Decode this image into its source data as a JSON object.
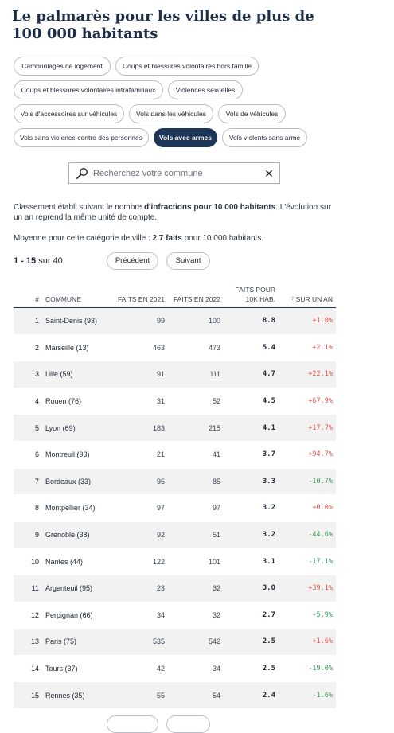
{
  "title": "Le palmarès pour les villes de plus de 100 000 habitants",
  "filters": [
    {
      "label": "Cambriolages de logement",
      "active": false
    },
    {
      "label": "Coups et blessures volontaires hors famille",
      "active": false
    },
    {
      "label": "Coups et blessures volontaires intrafamiliaux",
      "active": false
    },
    {
      "label": "Violences sexuelles",
      "active": false
    },
    {
      "label": "Vols d'accessoires sur véhicules",
      "active": false
    },
    {
      "label": "Vols dans les véhicules",
      "active": false
    },
    {
      "label": "Vols de véhicules",
      "active": false
    },
    {
      "label": "Vols sans violence contre des personnes",
      "active": false
    },
    {
      "label": "Vols avec armes",
      "active": true
    },
    {
      "label": "Vols violents sans arme",
      "active": false
    }
  ],
  "search": {
    "placeholder": "Recherchez votre commune",
    "clear_icon": "close-icon",
    "icon": "search-icon"
  },
  "info": {
    "line1_a": "Classement établi suivant le nombre ",
    "line1_b": "d'infractions pour 10 000 habitants",
    "line1_c": ". L'évolution sur un an reprend la même unité de compte.",
    "line2_a": "Moyenne pour cette catégorie de ville : ",
    "line2_b": "2.7 faits",
    "line2_c": " pour 10 000 habitants."
  },
  "pager": {
    "range": "1 - 15",
    "sep": " sur ",
    "total": "40",
    "prev": "Précédent",
    "next": "Suivant"
  },
  "table": {
    "headers": {
      "rank": "#",
      "city": "COMMUNE",
      "y2021": "FAITS EN 2021",
      "y2022": "FAITS EN 2022",
      "rate": "FAITS POUR 10K HAB.",
      "evo": "⁷ SUR UN AN"
    },
    "rows": [
      {
        "rank": "1",
        "city": "Saint-Denis (93)",
        "y2021": "99",
        "y2022": "100",
        "rate": "8.8",
        "evo": "+1.0%"
      },
      {
        "rank": "2",
        "city": "Marseille (13)",
        "y2021": "463",
        "y2022": "473",
        "rate": "5.4",
        "evo": "+2.1%"
      },
      {
        "rank": "3",
        "city": "Lille (59)",
        "y2021": "91",
        "y2022": "111",
        "rate": "4.7",
        "evo": "+22.1%"
      },
      {
        "rank": "4",
        "city": "Rouen (76)",
        "y2021": "31",
        "y2022": "52",
        "rate": "4.5",
        "evo": "+67.9%"
      },
      {
        "rank": "5",
        "city": "Lyon (69)",
        "y2021": "183",
        "y2022": "215",
        "rate": "4.1",
        "evo": "+17.7%"
      },
      {
        "rank": "6",
        "city": "Montreuil (93)",
        "y2021": "21",
        "y2022": "41",
        "rate": "3.7",
        "evo": "+94.7%"
      },
      {
        "rank": "7",
        "city": "Bordeaux (33)",
        "y2021": "95",
        "y2022": "85",
        "rate": "3.3",
        "evo": "-10.7%"
      },
      {
        "rank": "8",
        "city": "Montpellier (34)",
        "y2021": "97",
        "y2022": "97",
        "rate": "3.2",
        "evo": "+0.0%"
      },
      {
        "rank": "9",
        "city": "Grenoble (38)",
        "y2021": "92",
        "y2022": "51",
        "rate": "3.2",
        "evo": "-44.6%"
      },
      {
        "rank": "10",
        "city": "Nantes (44)",
        "y2021": "122",
        "y2022": "101",
        "rate": "3.1",
        "evo": "-17.1%"
      },
      {
        "rank": "11",
        "city": "Argenteuil (95)",
        "y2021": "23",
        "y2022": "32",
        "rate": "3.0",
        "evo": "+39.1%"
      },
      {
        "rank": "12",
        "city": "Perpignan (66)",
        "y2021": "34",
        "y2022": "32",
        "rate": "2.7",
        "evo": "-5.9%"
      },
      {
        "rank": "13",
        "city": "Paris (75)",
        "y2021": "535",
        "y2022": "542",
        "rate": "2.5",
        "evo": "+1.6%"
      },
      {
        "rank": "14",
        "city": "Tours (37)",
        "y2021": "42",
        "y2022": "34",
        "rate": "2.5",
        "evo": "-19.0%"
      },
      {
        "rank": "15",
        "city": "Rennes (35)",
        "y2021": "55",
        "y2022": "54",
        "rate": "2.4",
        "evo": "-1.6%"
      }
    ]
  },
  "colors": {
    "accent": "#1d3557",
    "positive": "#e0524a",
    "negative": "#3b9a57"
  }
}
